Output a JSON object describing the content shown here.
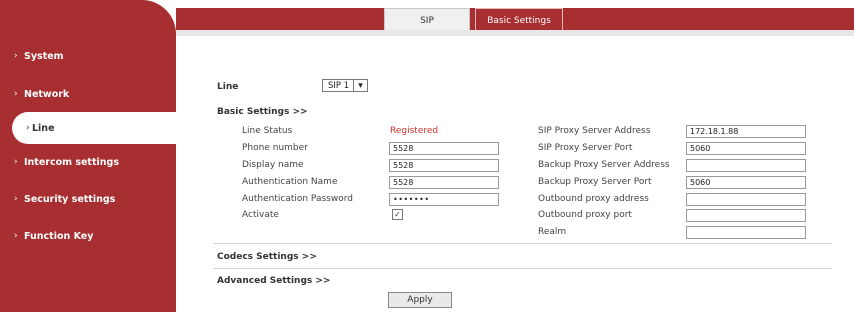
{
  "tabs": [
    {
      "label": "SIP",
      "active": false
    },
    {
      "label": "Basic Settings",
      "active": true
    }
  ],
  "sidebar": {
    "items": [
      {
        "label": "System",
        "active": false
      },
      {
        "label": "Network",
        "active": false
      },
      {
        "label": "Line",
        "active": true
      },
      {
        "label": "Intercom settings",
        "active": false
      },
      {
        "label": "Security settings",
        "active": false
      },
      {
        "label": "Function Key",
        "active": false
      }
    ],
    "chevron": "›"
  },
  "line": {
    "label": "Line",
    "selected": "SIP 1"
  },
  "sections": {
    "basic": "Basic Settings >>",
    "codecs": "Codecs Settings >>",
    "advanced": "Advanced Settings >>"
  },
  "left_fields": {
    "line_status": {
      "label": "Line Status",
      "value": "Registered"
    },
    "phone_number": {
      "label": "Phone number",
      "value": "5528"
    },
    "display_name": {
      "label": "Display name",
      "value": "5528"
    },
    "auth_name": {
      "label": "Authentication Name",
      "value": "5528"
    },
    "auth_password": {
      "label": "Authentication Password",
      "value": "•••••••"
    },
    "activate": {
      "label": "Activate",
      "checked": true,
      "mark": "✓"
    }
  },
  "right_fields": {
    "proxy_addr": {
      "label": "SIP Proxy Server Address",
      "value": "172.18.1.88"
    },
    "proxy_port": {
      "label": "SIP Proxy Server Port",
      "value": "5060"
    },
    "backup_addr": {
      "label": "Backup Proxy Server Address",
      "value": ""
    },
    "backup_port": {
      "label": "Backup Proxy Server Port",
      "value": "5060"
    },
    "outbound_addr": {
      "label": "Outbound proxy address",
      "value": ""
    },
    "outbound_port": {
      "label": "Outbound proxy port",
      "value": ""
    },
    "realm": {
      "label": "Realm",
      "value": ""
    }
  },
  "apply_label": "Apply",
  "colors": {
    "brand": "#a82f31",
    "status_registered": "#d6332e"
  }
}
